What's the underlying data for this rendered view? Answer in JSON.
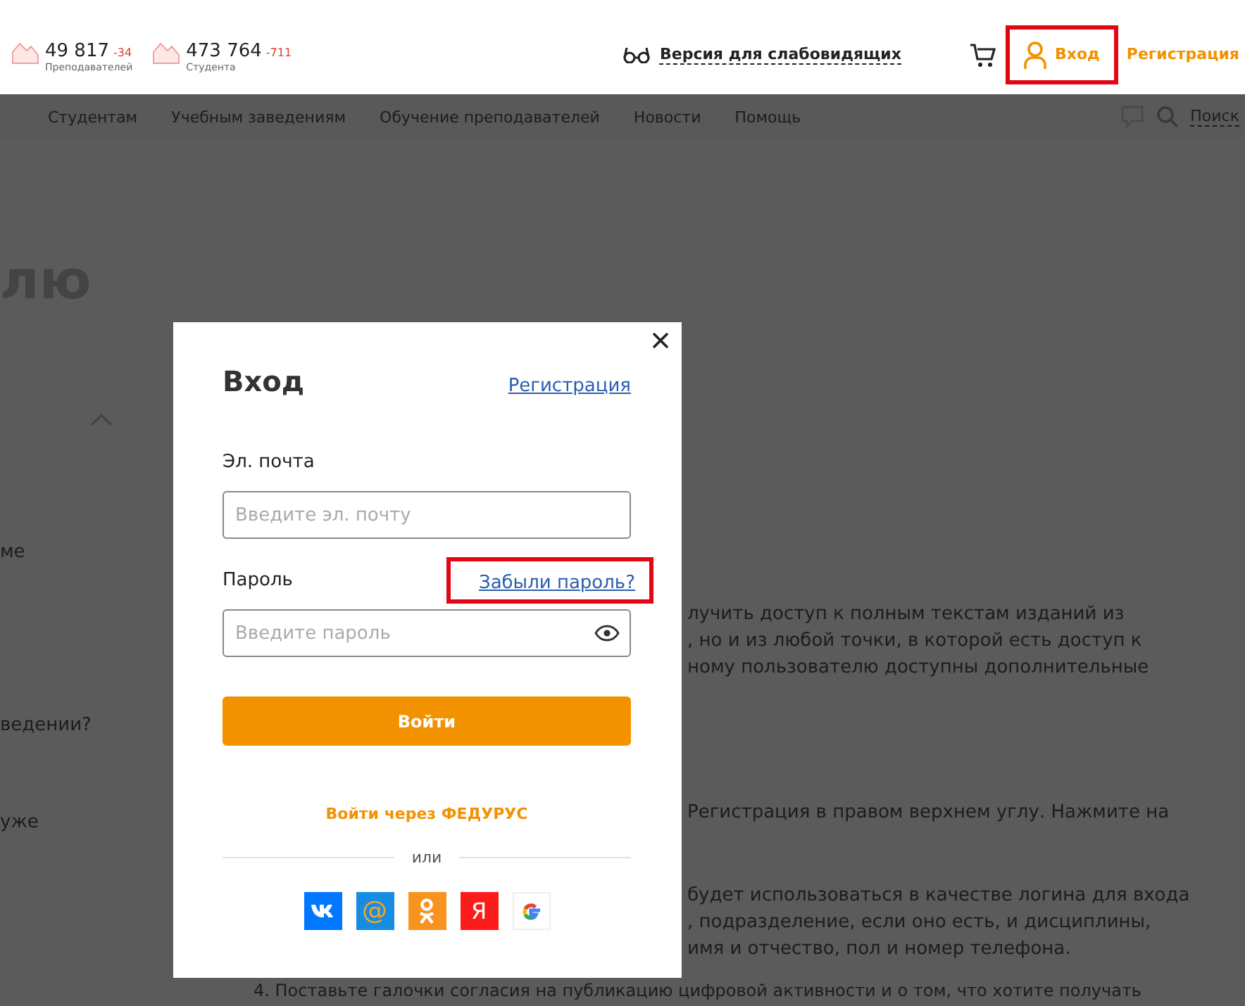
{
  "header": {
    "stats": [
      {
        "value": "49 817",
        "delta": "-34",
        "label": "Преподавателей"
      },
      {
        "value": "473 764",
        "delta": "-711",
        "label": "Студента"
      }
    ],
    "accessibility_link": "Версия для слабовидящих",
    "login": {
      "label": "Вход",
      "highlighted": true
    },
    "register": "Регистрация"
  },
  "nav": {
    "items": [
      "Студентам",
      "Учебным заведениям",
      "Обучение преподавателей",
      "Новости",
      "Помощь"
    ],
    "search": "Поиск"
  },
  "background": {
    "heading": "лю",
    "left_texts": [
      "ме",
      "ведении?",
      "уже"
    ],
    "paragraphs": [
      [
        "лучить доступ к полным текстам изданий из",
        ", но и из любой точки, в которой есть доступ к",
        "ному пользователю доступны дополнительные"
      ],
      [
        "Регистрация в правом верхнем углу. Нажмите на"
      ],
      [
        "будет использоваться в качестве логина для входа",
        ", подразделение, если оно есть, и дисциплины,",
        "имя и отчество, пол и номер телефона."
      ]
    ],
    "footer_line": "4. Поставьте галочки согласия на публикацию цифровой активности и о том, что хотите получать"
  },
  "dialog": {
    "title": "Вход",
    "register_link": "Регистрация",
    "fields": [
      {
        "kind": "email",
        "label": "Эл. почта",
        "placeholder": "Введите эл. почту"
      },
      {
        "kind": "password",
        "label": "Пароль",
        "placeholder": "Введите пароль",
        "link": {
          "label": "Забыли пароль?",
          "highlighted": true
        }
      }
    ],
    "submit": "Войти",
    "alt_login": "Войти через ФЕДУРУС",
    "divider": "или",
    "social": [
      {
        "kind": "vk"
      },
      {
        "kind": "mail",
        "glyph": "@"
      },
      {
        "kind": "ok"
      },
      {
        "kind": "yandex",
        "glyph": "Я"
      },
      {
        "kind": "google"
      }
    ]
  }
}
